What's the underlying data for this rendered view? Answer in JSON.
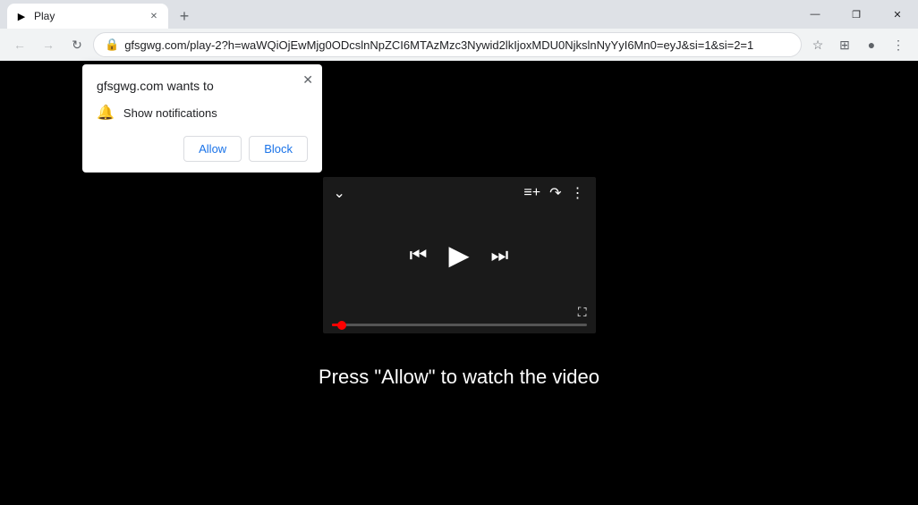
{
  "titleBar": {
    "tab": {
      "title": "Play",
      "favicon": "▶"
    },
    "newTabLabel": "+",
    "windowControls": {
      "minimize": "—",
      "maximize": "❐",
      "close": "✕"
    }
  },
  "addressBar": {
    "backBtn": "←",
    "forwardBtn": "→",
    "reloadBtn": "↻",
    "url": "gfsgwg.com/play-2?h=waWQiOjEwMjg0ODcslnNpZCI6MTAzMzc3Nywid2lkIjoxMDU0NjkslnNyYyI6Mn0=eyJ&si=1&si=2=1",
    "starIcon": "☆",
    "extensionsIcon": "⊞",
    "profileIcon": "●",
    "menuIcon": "⋮"
  },
  "notificationPopup": {
    "title": "gfsgwg.com wants to",
    "closeBtn": "✕",
    "bellIcon": "🔔",
    "permissionText": "Show notifications",
    "allowBtn": "Allow",
    "blockBtn": "Block"
  },
  "videoPlayer": {
    "chevronDown": "⌄",
    "addToQueueIcon": "≡+",
    "shareIcon": "↷",
    "moreIcon": "⋮",
    "prevIcon": "⏮",
    "playIcon": "▶",
    "nextIcon": "⏭",
    "fullscreenIcon": "⛶",
    "progressPercent": 4
  },
  "pageText": "Press \"Allow\" to watch the video",
  "colors": {
    "progressRed": "#f00",
    "background": "#000",
    "playerBg": "#1a1a1a"
  }
}
